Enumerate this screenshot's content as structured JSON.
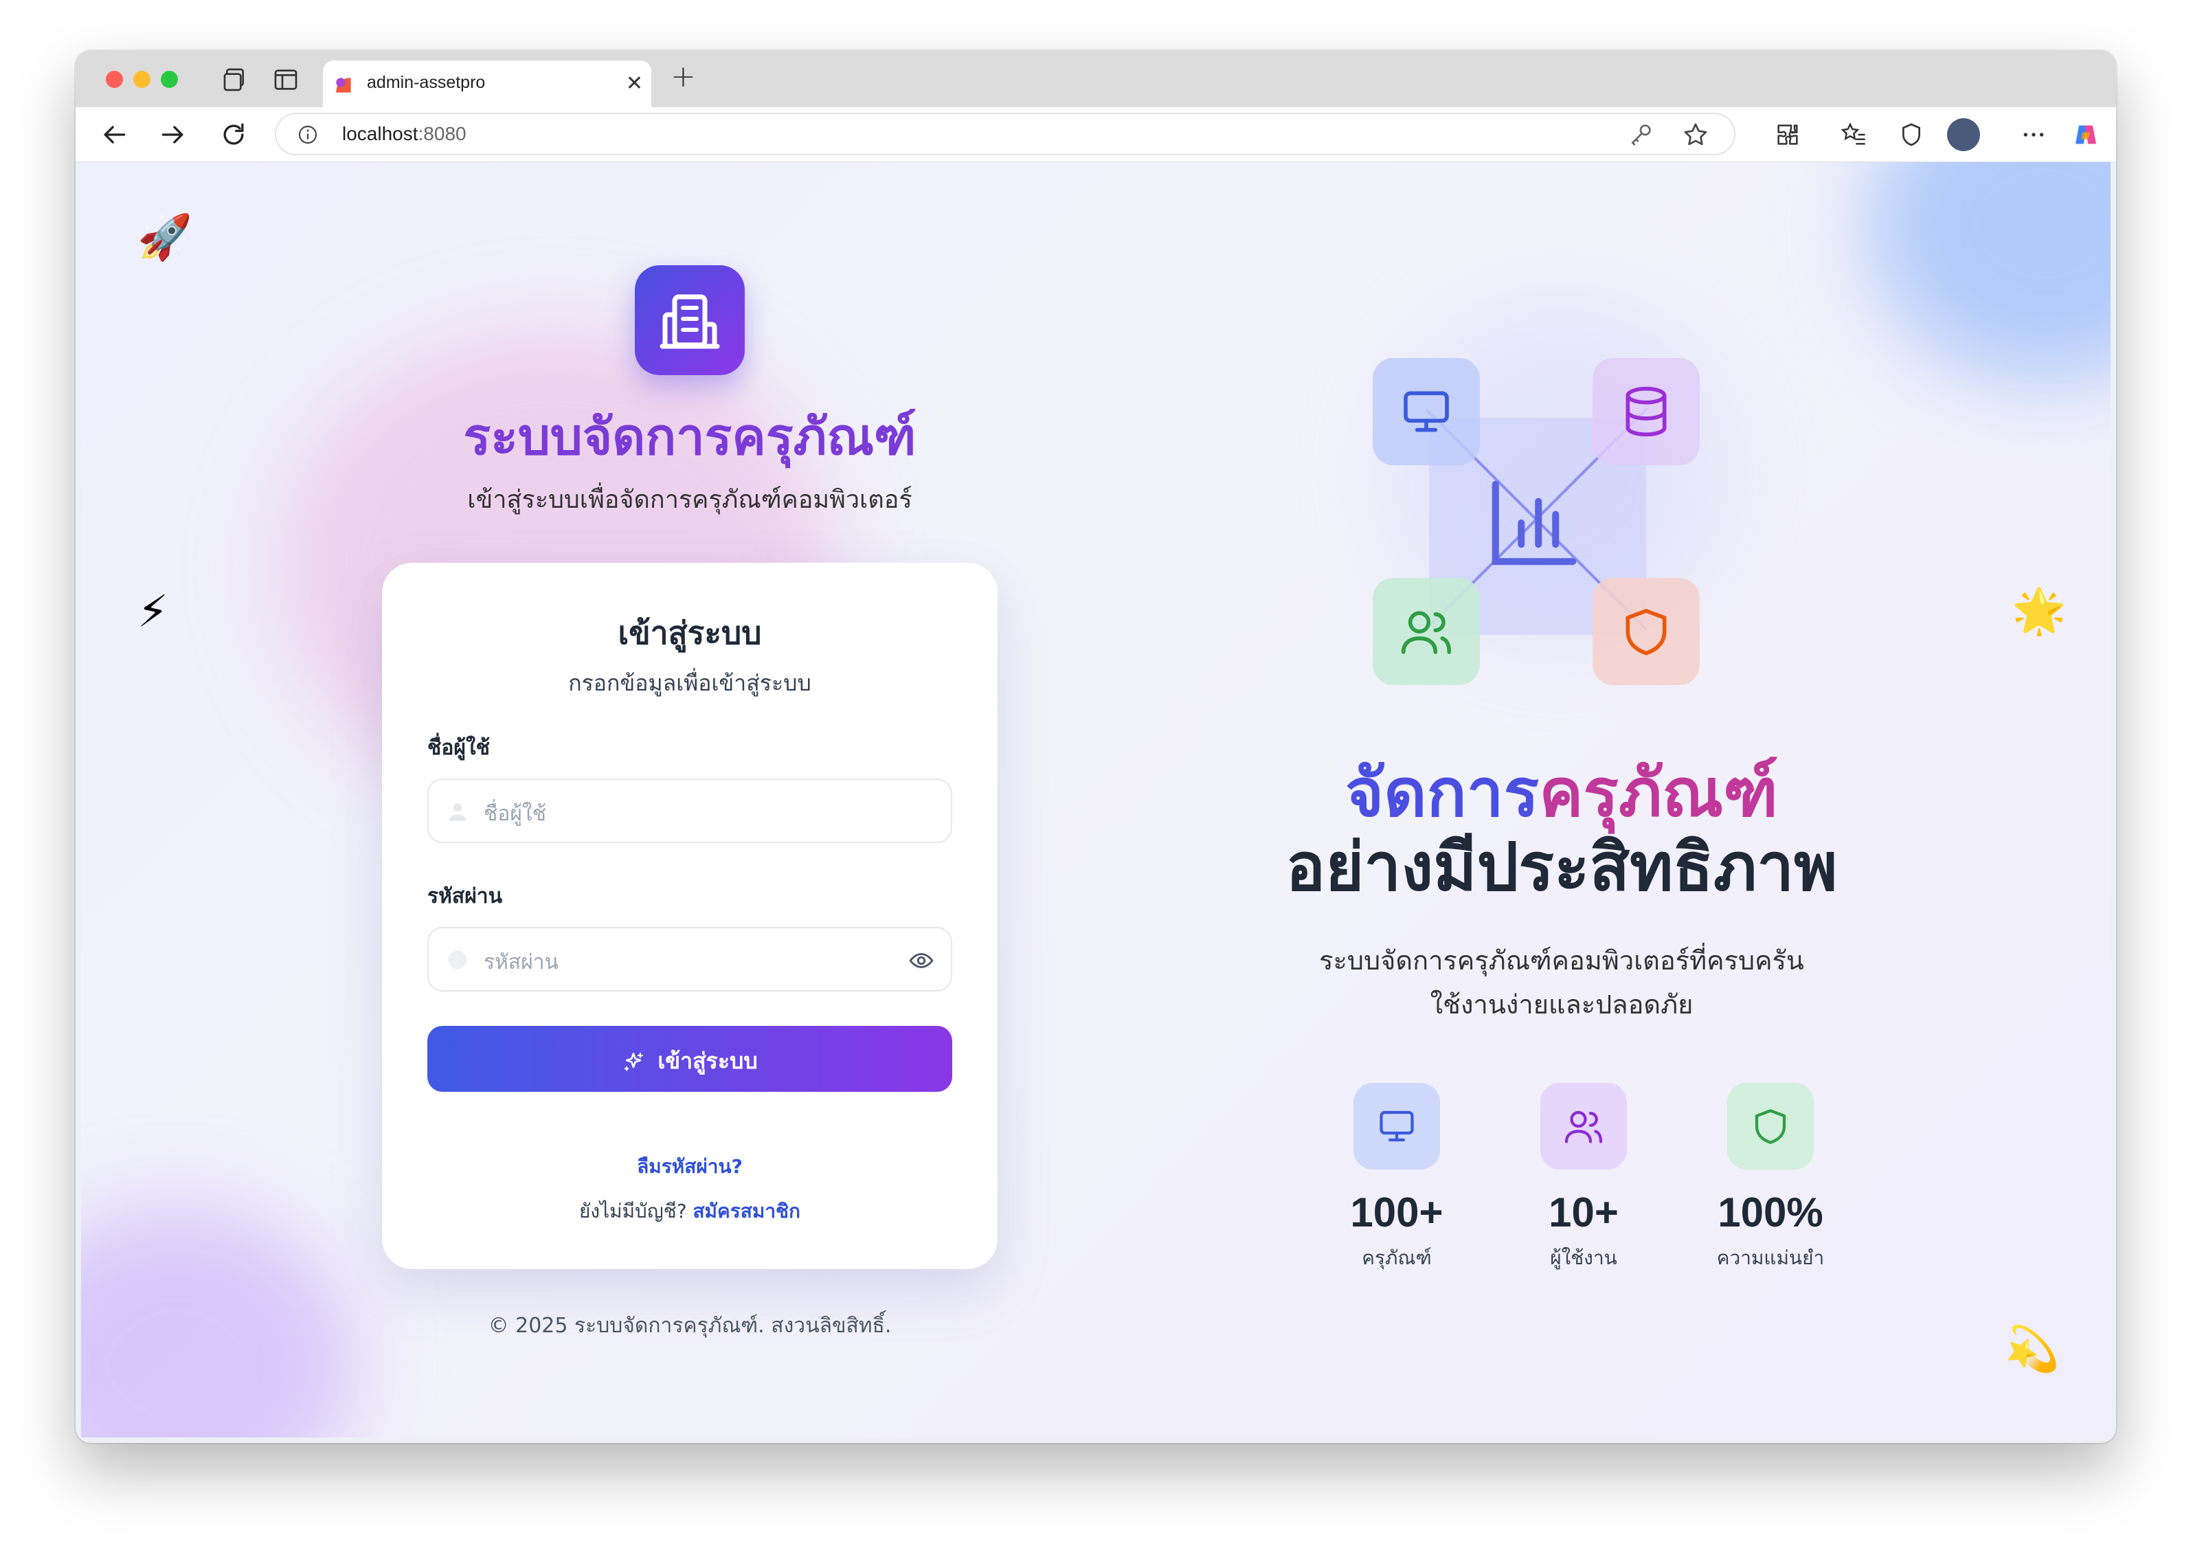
{
  "browser": {
    "tab_title": "admin-assetpro",
    "url_host": "localhost",
    "url_port": ":8080"
  },
  "brand": {
    "title": "ระบบจัดการครุภัณฑ์",
    "subtitle": "เข้าสู่ระบบเพื่อจัดการครุภัณฑ์คอมพิวเตอร์"
  },
  "login": {
    "title": "เข้าสู่ระบบ",
    "subtitle": "กรอกข้อมูลเพื่อเข้าสู่ระบบ",
    "username_label": "ชื่อผู้ใช้",
    "username_placeholder": "ชื่อผู้ใช้",
    "password_label": "รหัสผ่าน",
    "password_placeholder": "รหัสผ่าน",
    "submit_label": "เข้าสู่ระบบ",
    "forgot_label": "ลืมรหัสผ่าน?",
    "no_account_text": "ยังไม่มีบัญชี?",
    "register_label": "สมัครสมาชิก"
  },
  "footer": {
    "copyright": "© 2025 ระบบจัดการครุภัณฑ์. สงวนลิขสิทธิ์."
  },
  "hero": {
    "headline_part1": "จัดการ",
    "headline_part2": "ครุภัณฑ์",
    "headline_line2": "อย่างมีประสิทธิภาพ",
    "desc_line1": "ระบบจัดการครุภัณฑ์คอมพิวเตอร์ที่ครบครัน",
    "desc_line2": "ใช้งานง่ายและปลอดภัย"
  },
  "illustration": {
    "icons": [
      "monitor-icon",
      "database-icon",
      "users-icon",
      "shield-icon",
      "bar-chart-icon"
    ]
  },
  "stats": [
    {
      "value": "100+",
      "label": "ครุภัณฑ์",
      "icon": "monitor-icon"
    },
    {
      "value": "10+",
      "label": "ผู้ใช้งาน",
      "icon": "users-icon"
    },
    {
      "value": "100%",
      "label": "ความแม่นยำ",
      "icon": "shield-icon"
    }
  ],
  "decorations": {
    "rocket": "🚀",
    "bolt": "⚡",
    "star": "🌟",
    "comet": "💫"
  },
  "colors": {
    "primary": "#4a4fe0",
    "accent": "#8a38e6",
    "link": "#2f4fd8"
  }
}
